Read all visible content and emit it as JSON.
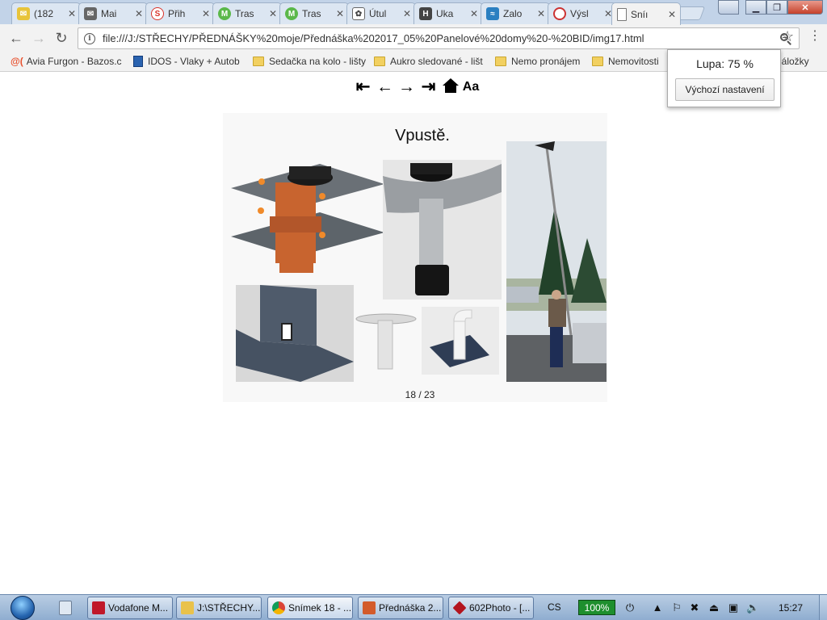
{
  "tabs": [
    {
      "title": "(182",
      "icon": "mail-envelope-icon",
      "color": "#e8c43a"
    },
    {
      "title": "Mai",
      "icon": "envelope-icon",
      "color": "#555555"
    },
    {
      "title": "Přih",
      "icon": "s-logo-icon",
      "color": "#d9342b"
    },
    {
      "title": "Tras",
      "icon": "m-logo-icon",
      "color": "#5bb84a"
    },
    {
      "title": "Tras",
      "icon": "m-logo-icon",
      "color": "#5bb84a"
    },
    {
      "title": "Útul",
      "icon": "paw-icon",
      "color": "#666666"
    },
    {
      "title": "Uka",
      "icon": "h-logo-icon",
      "color": "#444444"
    },
    {
      "title": "Zalo",
      "icon": "wave-logo-icon",
      "color": "#2a7fc1"
    },
    {
      "title": "Výsl",
      "icon": "red-circle-icon",
      "color": "#cc3333"
    },
    {
      "title": "Sníı",
      "icon": "page-icon",
      "color": "#ffffff"
    }
  ],
  "tab_close_glyph": "✕",
  "omnibox": {
    "url": "file:///J:/STŘECHY/PŘEDNÁŠKY%20moje/Přednáška%202017_05%20Panelové%20domy%20-%20BID/img17.html"
  },
  "bookmarks": [
    {
      "label": "Avia Furgon - Bazos.c",
      "icon": "at-icon"
    },
    {
      "label": "IDOS - Vlaky + Autob",
      "icon": "idos-icon"
    },
    {
      "label": "Sedačka na kolo - lišty",
      "icon": "folder-icon"
    },
    {
      "label": "Aukro sledované - lišt",
      "icon": "folder-icon"
    },
    {
      "label": "Nemo pronájem",
      "icon": "folder-icon"
    },
    {
      "label": "Nemovitosti",
      "icon": "folder-icon"
    },
    {
      "label": "í záložky",
      "icon": "folder-icon"
    }
  ],
  "zoom_popup": {
    "label": "Lupa: 75 %",
    "reset_button": "Výchozí nastavení"
  },
  "page": {
    "nav_text_button": "Aa",
    "slide_title": "Vpustě.",
    "counter": "18 / 23"
  },
  "taskbar": {
    "tasks": [
      {
        "label": "Vodafone M...",
        "color": "#c0182a"
      },
      {
        "label": "J:\\STŘECHY...",
        "color": "#e9c24b"
      },
      {
        "label": "Snímek 18 - ...",
        "color": "#4a90d9"
      },
      {
        "label": "Přednáška 2...",
        "color": "#d35b2b"
      },
      {
        "label": "602Photo - [...",
        "color": "#b3141e"
      }
    ],
    "language": "CS",
    "battery": "100%",
    "clock": "15:27"
  }
}
